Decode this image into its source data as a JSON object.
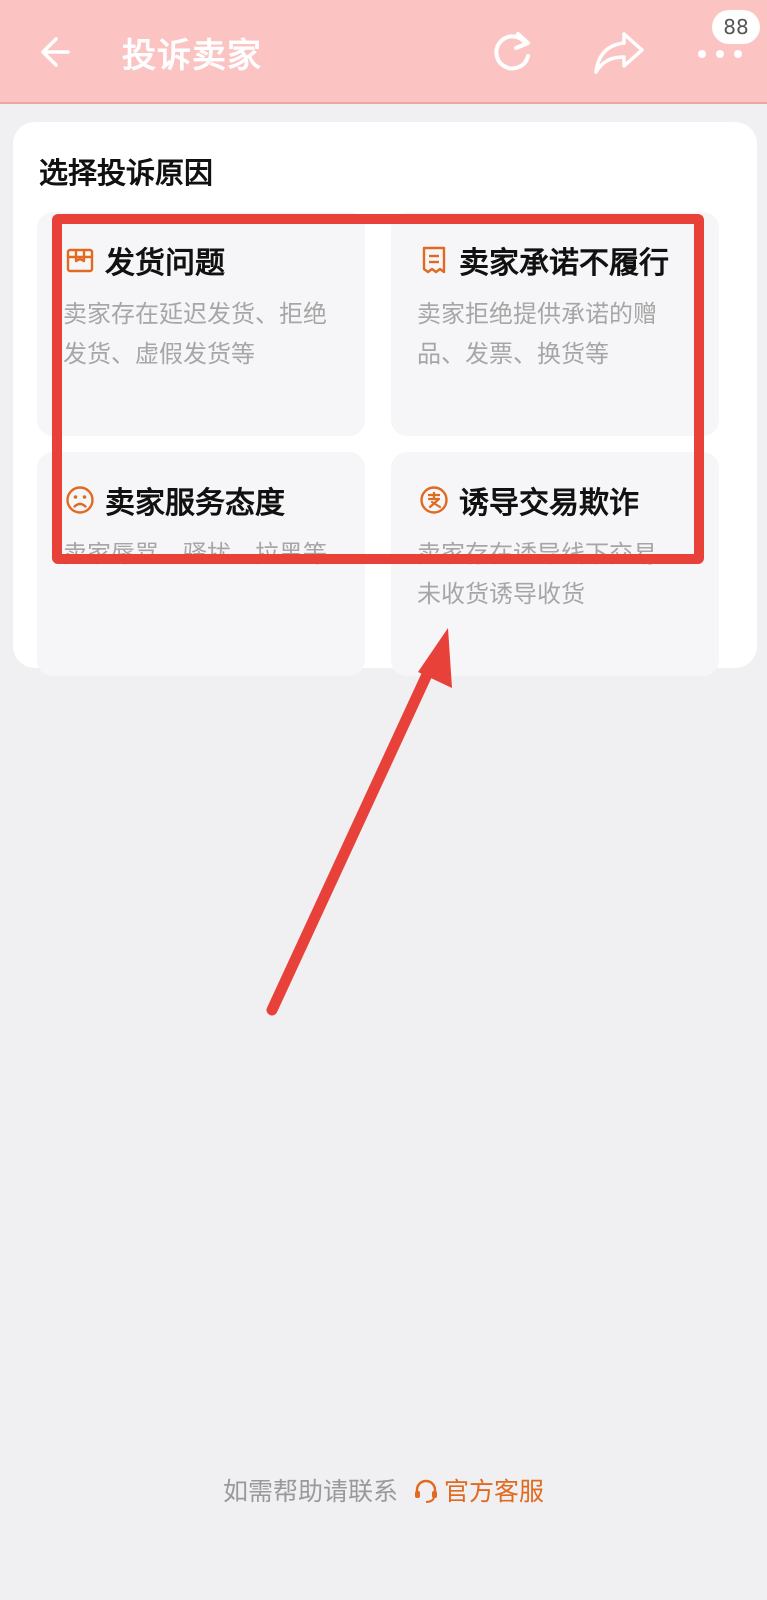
{
  "header": {
    "title": "投诉卖家",
    "badge": "88",
    "bg_color": "#fbc4c2"
  },
  "section": {
    "title": "选择投诉原因",
    "options": [
      {
        "icon": "package-icon",
        "title": "发货问题",
        "desc": "卖家存在延迟发货、拒绝发货、虚假发货等"
      },
      {
        "icon": "receipt-icon",
        "title": "卖家承诺不履行",
        "desc": "卖家拒绝提供承诺的赠品、发票、换货等"
      },
      {
        "icon": "sad-face-icon",
        "title": "卖家服务态度",
        "desc": "卖家辱骂、骚扰、拉黑等"
      },
      {
        "icon": "alipay-icon",
        "title": "诱导交易欺诈",
        "desc": "卖家存在诱导线下交易、未收货诱导收货"
      }
    ]
  },
  "footer": {
    "prompt": "如需帮助请联系",
    "link_label": "官方客服"
  },
  "colors": {
    "accent": "#e06a20",
    "annotation": "#e8413a"
  }
}
